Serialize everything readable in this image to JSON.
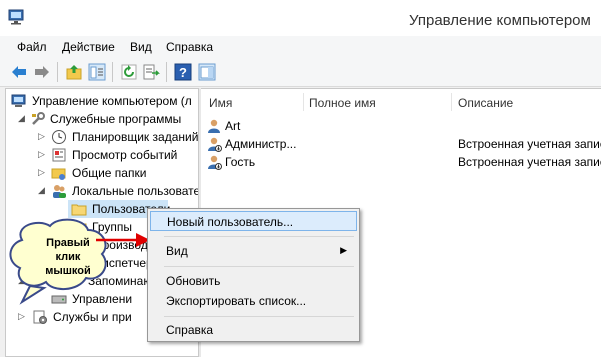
{
  "window": {
    "title": "Управление компьютером"
  },
  "menu": [
    "Файл",
    "Действие",
    "Вид",
    "Справка"
  ],
  "toolbar": {
    "icons": [
      "back-arrow-icon",
      "forward-arrow-icon",
      "up-folder-icon",
      "show-hide-tree-icon",
      "refresh-icon",
      "export-list-icon",
      "help-icon",
      "properties-pane-icon"
    ]
  },
  "tree": {
    "root": "Управление компьютером (л",
    "system_tools": "Служебные программы",
    "task_scheduler": "Планировщик заданий",
    "event_viewer": "Просмотр событий",
    "shared_folders": "Общие папки",
    "local_users": "Локальные пользовате",
    "users": "Пользователи",
    "groups": "Группы",
    "performance": "Производ",
    "device_manager": "Диспетчер",
    "storage": "Запоминающ",
    "disk_management": "Управлени",
    "services": "Службы и при"
  },
  "list": {
    "columns": {
      "name": "Имя",
      "full_name": "Полное имя",
      "description": "Описание"
    },
    "rows": [
      {
        "name": "Art",
        "full_name": "",
        "description": ""
      },
      {
        "name": "Администр...",
        "full_name": "",
        "description": "Встроенная учетная запис"
      },
      {
        "name": "Гость",
        "full_name": "",
        "description": "Встроенная учетная запис"
      }
    ]
  },
  "context_menu": {
    "new_user": "Новый пользователь...",
    "view": "Вид",
    "refresh": "Обновить",
    "export": "Экспортировать список...",
    "help": "Справка"
  },
  "callout": {
    "line1": "Правый",
    "line2": "клик",
    "line3": "мышкой"
  },
  "colors": {
    "highlight": "#dcecfc",
    "callout_fill": "#ffffd0",
    "arrow": "#e00000"
  }
}
